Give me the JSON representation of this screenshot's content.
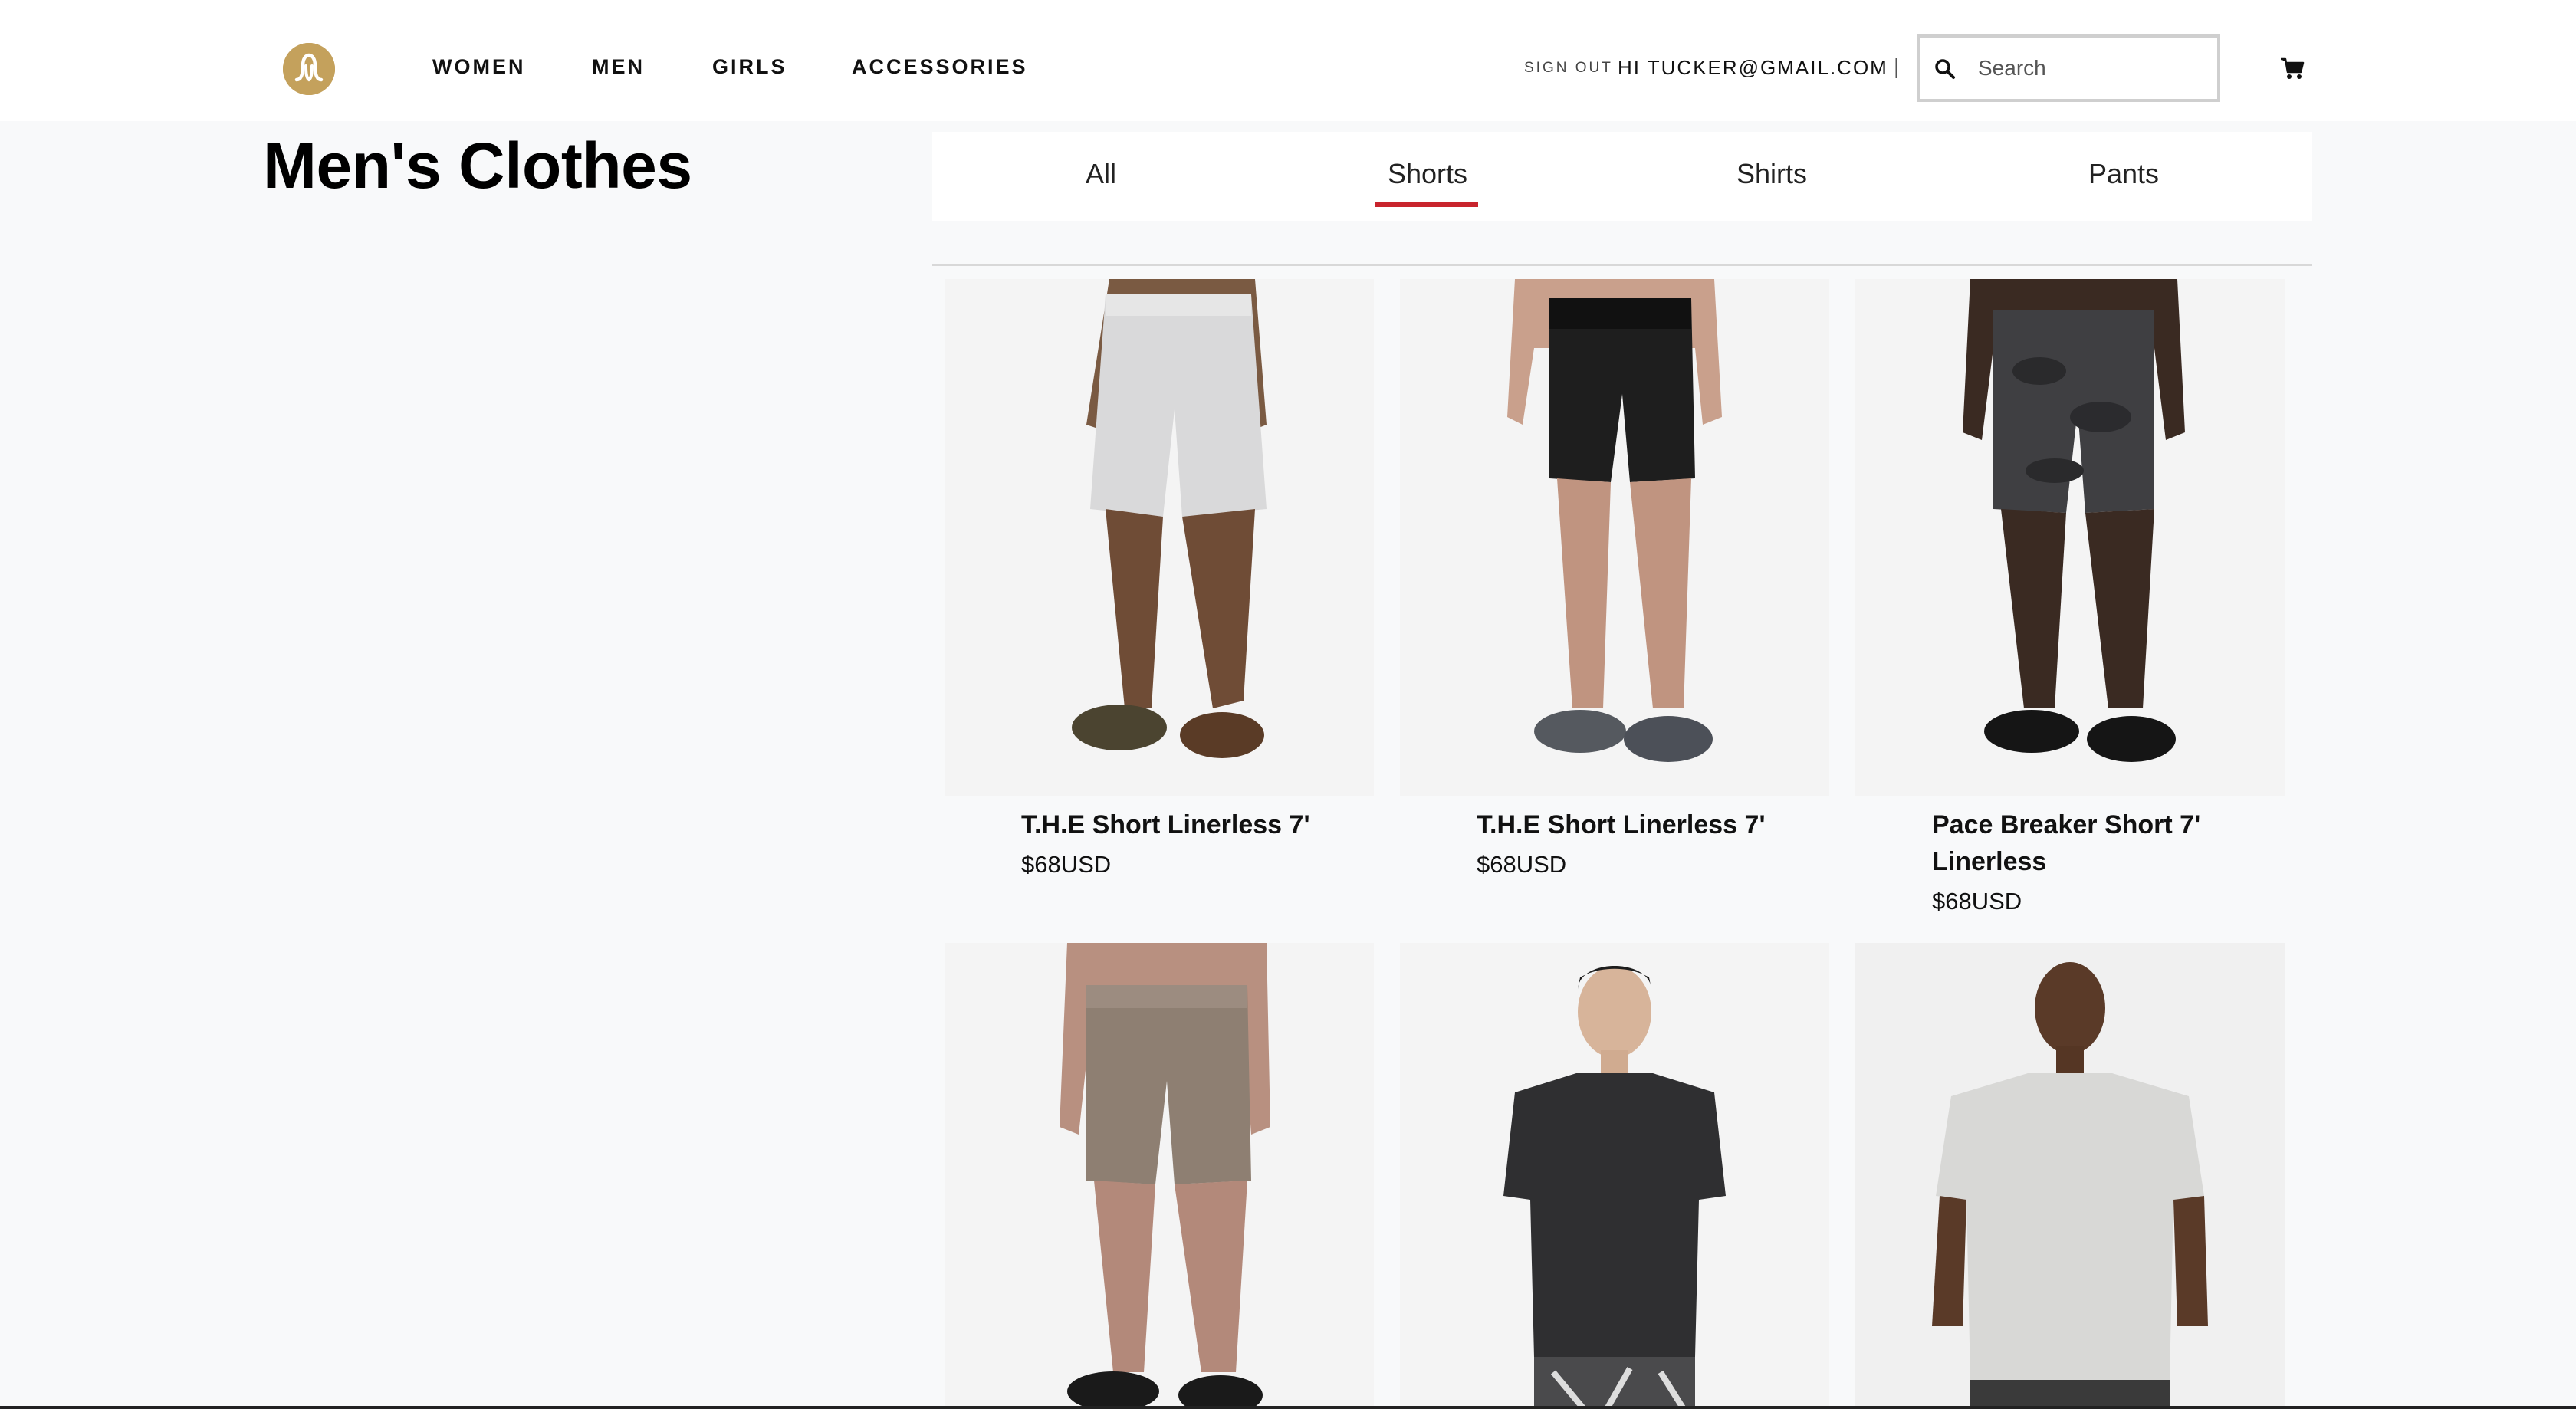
{
  "header": {
    "logo_name": "lululemon-logo",
    "nav": [
      {
        "label": "WOMEN"
      },
      {
        "label": "MEN"
      },
      {
        "label": "GIRLS"
      },
      {
        "label": "ACCESSORIES"
      }
    ],
    "sign_out": "SIGN OUT",
    "greeting": "HI TUCKER@GMAIL.COM",
    "divider": "|",
    "search_placeholder": "Search",
    "cart_icon": "cart-icon"
  },
  "page": {
    "title": "Men's Clothes"
  },
  "tabs": {
    "items": [
      {
        "label": "All"
      },
      {
        "label": "Shorts"
      },
      {
        "label": "Shirts"
      },
      {
        "label": "Pants"
      }
    ],
    "active": "Shorts"
  },
  "products": [
    {
      "name": "T.H.E Short Linerless 7'",
      "price": "$68USD"
    },
    {
      "name": "T.H.E Short Linerless 7'",
      "price": "$68USD"
    },
    {
      "name": "Pace Breaker Short 7' Linerless",
      "price": "$68USD"
    },
    {
      "name": "",
      "price": ""
    },
    {
      "name": "",
      "price": ""
    },
    {
      "name": "",
      "price": ""
    }
  ],
  "colors": {
    "logo": "#c4a15c",
    "active_tab_underline": "#c8242d",
    "background": "#f8f9fa"
  }
}
